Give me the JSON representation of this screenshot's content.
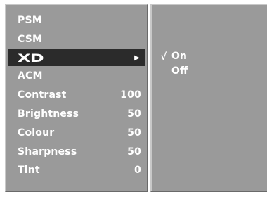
{
  "menu": {
    "items": [
      {
        "label": "PSM",
        "value": ""
      },
      {
        "label": "CSM",
        "value": ""
      },
      {
        "label": "XD",
        "value": "▶"
      },
      {
        "label": "ACM",
        "value": ""
      },
      {
        "label": "Contrast",
        "value": "100"
      },
      {
        "label": "Brightness",
        "value": "50"
      },
      {
        "label": "Colour",
        "value": "50"
      },
      {
        "label": "Sharpness",
        "value": "50"
      },
      {
        "label": "Tint",
        "value": "0"
      }
    ],
    "selected_index": 2
  },
  "submenu": {
    "check_mark": "√",
    "options": [
      {
        "label": "On",
        "checked": true
      },
      {
        "label": "Off",
        "checked": false
      }
    ]
  },
  "colors": {
    "panel": "#9a9a9a",
    "selected_row": "#2b2b2b",
    "text": "#ffffff"
  }
}
